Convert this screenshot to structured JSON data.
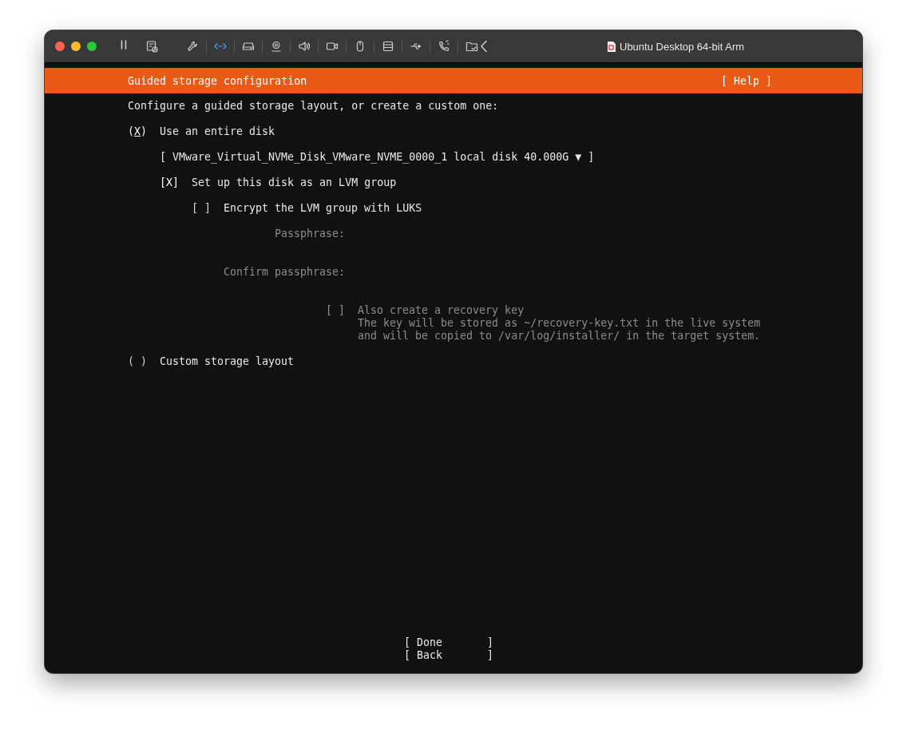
{
  "window": {
    "title": "Ubuntu Desktop 64-bit Arm"
  },
  "header": {
    "title": "Guided storage configuration",
    "help": "[ Help ]"
  },
  "intro": "Configure a guided storage layout, or create a custom one:",
  "disk_option": {
    "marker": "(X)",
    "selected": true,
    "focused": true,
    "label": "Use an entire disk"
  },
  "disk_select": {
    "value": "[ VMware_Virtual_NVMe_Disk_VMware_NVME_0000_1 local disk 40.000G ▼ ]"
  },
  "lvm": {
    "marker": "[X]",
    "checked": true,
    "label": "Set up this disk as an LVM group"
  },
  "luks": {
    "marker": "[ ]",
    "checked": false,
    "label": "Encrypt the LVM group with LUKS"
  },
  "passphrase": {
    "label": "Passphrase:",
    "disabled": true
  },
  "confirm_passphrase": {
    "label": "Confirm passphrase:",
    "disabled": true
  },
  "recovery": {
    "marker": "[ ]",
    "checked": false,
    "label": "Also create a recovery key",
    "disabled": true,
    "help": [
      "The key will be stored as ~/recovery-key.txt in the live system",
      "and will be copied to /var/log/installer/ in the target system."
    ]
  },
  "custom_option": {
    "marker": "( )",
    "selected": false,
    "focused": false,
    "label": "Custom storage layout"
  },
  "buttons": [
    {
      "label": "[ Done       ]"
    },
    {
      "label": "[ Back       ]"
    }
  ]
}
